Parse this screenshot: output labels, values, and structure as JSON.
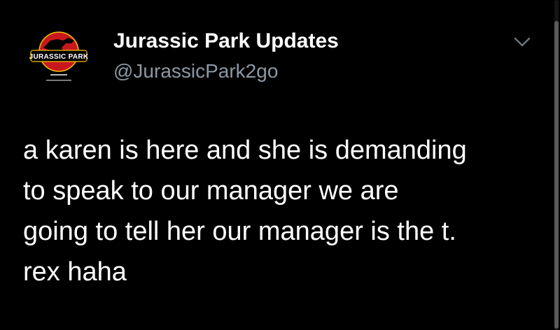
{
  "tweet": {
    "author": {
      "display_name": "Jurassic Park Updates",
      "handle": "@JurassicPark2go",
      "avatar_icon": "jurassic-park-logo",
      "avatar_logo_text": "JURASSIC PARK"
    },
    "menu_icon": "chevron-down-icon",
    "text_lines": [
      "a karen is here and she is demanding",
      "to speak to our manager we are",
      "going to tell her our manager is the t.",
      "rex haha"
    ]
  },
  "colors": {
    "background": "#000000",
    "text": "#ffffff",
    "secondary_text": "#8b98a5",
    "logo_red": "#c8181e",
    "logo_yellow": "#f2c200"
  }
}
